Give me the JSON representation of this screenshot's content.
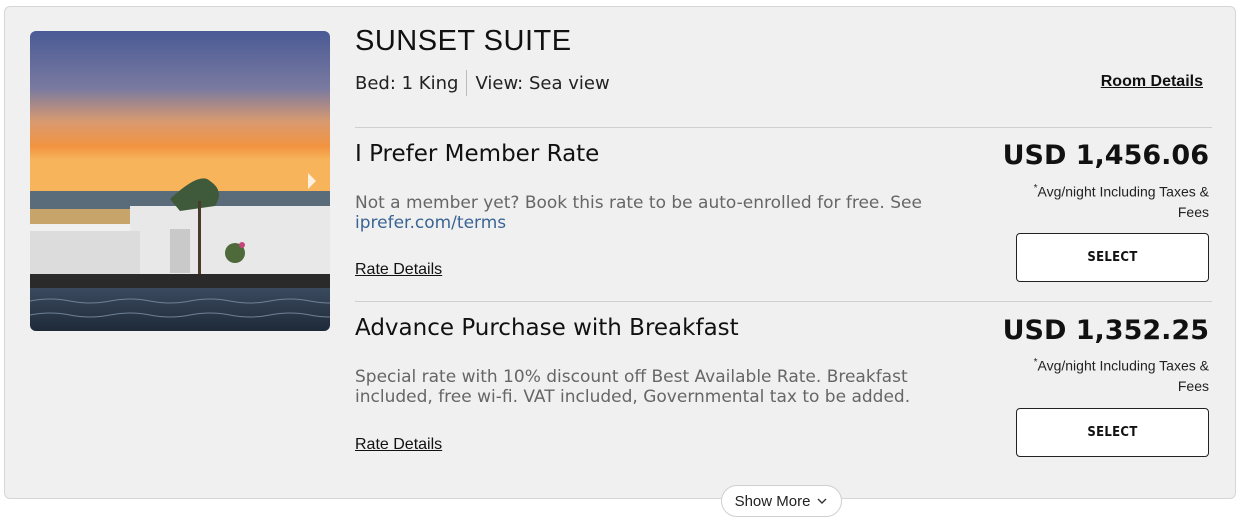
{
  "room": {
    "title": "SUNSET SUITE",
    "bed": "Bed: 1 King",
    "view": "View: Sea view",
    "details_link": "Room Details",
    "photo_alt": "Sunset suite pool view photo"
  },
  "rates": [
    {
      "name": "I Prefer Member Rate",
      "description": "Not a member yet? Book this rate to be auto-enrolled for free. See ",
      "description_link": "iprefer.com/terms",
      "details_link": "Rate Details",
      "price": "USD 1,456.06",
      "note_mark": "*",
      "note": "Avg/night Including Taxes & Fees",
      "select_label": "SELECT"
    },
    {
      "name": "Advance Purchase with Breakfast",
      "description": "Special rate with 10% discount off Best Available Rate. Breakfast included, free wi-fi. VAT included, Governmental tax to be added.",
      "description_link": "",
      "details_link": "Rate Details",
      "price": "USD 1,352.25",
      "note_mark": "*",
      "note": "Avg/night Including Taxes & Fees",
      "select_label": "SELECT"
    }
  ],
  "show_more_label": "Show More",
  "colors": {
    "card_bg": "#f0f0f0",
    "link_blue": "#3a6494",
    "desc_gray": "#666666"
  },
  "icons": {
    "carousel_next": "chevron-right-icon",
    "show_more": "chevron-down-icon"
  }
}
